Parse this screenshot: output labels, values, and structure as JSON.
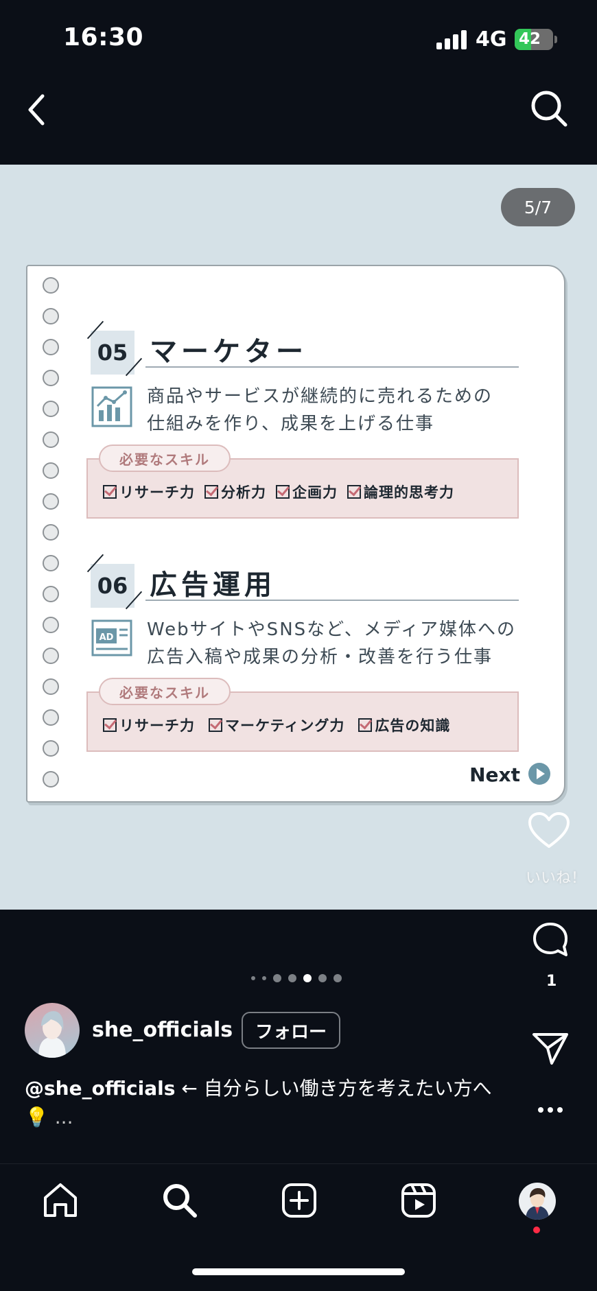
{
  "status_bar": {
    "time": "16:30",
    "network": "4G",
    "battery": "42",
    "battery_level": 0.42
  },
  "post": {
    "page_counter": "5/7",
    "slide": {
      "sections": [
        {
          "number": "05",
          "title": "マーケター",
          "icon": "chart-icon",
          "description_lines": [
            "商品やサービスが継続的に売れるための",
            "仕組みを作り、成果を上げる仕事"
          ],
          "skills_tag": "必要なスキル",
          "skills": [
            "リサーチ力",
            "分析力",
            "企画力",
            "論理的思考力"
          ]
        },
        {
          "number": "06",
          "title": "広告運用",
          "icon": "ad-icon",
          "description_lines": [
            "WebサイトやSNSなど、メディア媒体への",
            "広告入稿や成果の分析・改善を行う仕事"
          ],
          "skills_tag": "必要なスキル",
          "skills": [
            "リサーチ力",
            "マーケティング力",
            "広告の知識"
          ]
        }
      ],
      "next_label": "Next"
    },
    "carousel": {
      "count": 7,
      "active_index": 4
    },
    "actions": {
      "like_label": "いいね！",
      "comment_count": "1"
    },
    "author": {
      "username": "she_officials",
      "follow_label": "フォロー"
    },
    "caption": {
      "mention": "@she_officials",
      "text": " ← 自分らしい働き方を考えたい方へ💡 ",
      "more": "..."
    }
  },
  "colors": {
    "background": "#0b0f17",
    "media_bg": "#d5e1e7",
    "accent_pink": "#c56a74",
    "notification": "#ff2b45"
  }
}
